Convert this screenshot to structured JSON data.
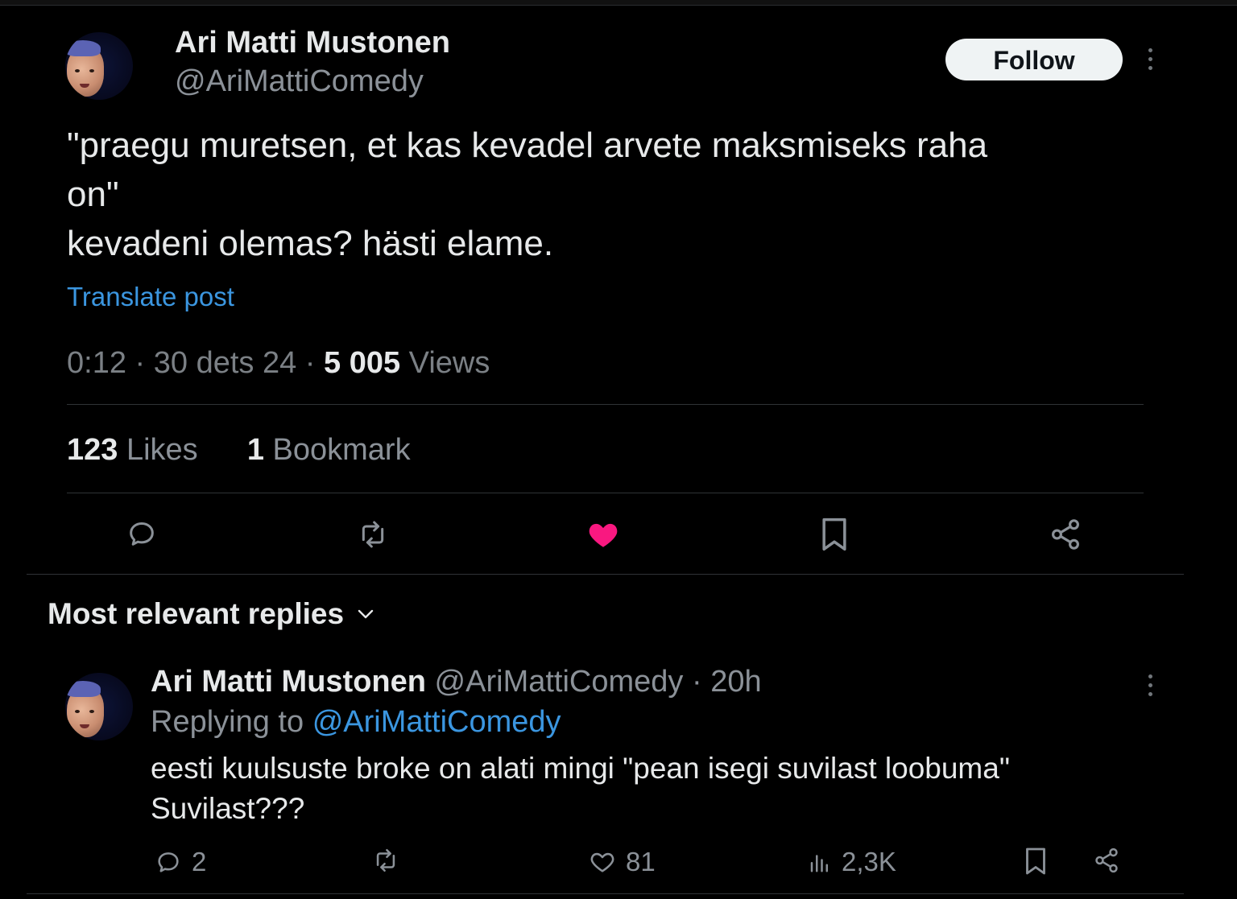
{
  "post": {
    "author_name": "Ari Matti Mustonen",
    "author_handle": "@AriMattiComedy",
    "follow_label": "Follow",
    "text_line1": "\"praegu muretsen, et kas kevadel arvete maksmiseks raha",
    "text_line2": "on\"",
    "text_line3": "kevadeni olemas? hästi elame.",
    "translate_label": "Translate post",
    "time": "0:12",
    "date": "30 dets 24",
    "views_count": "5 005",
    "views_label": "Views",
    "likes_count": "123",
    "likes_label": "Likes",
    "bookmarks_count": "1",
    "bookmarks_label": "Bookmark",
    "liked": true,
    "like_color": "#f91880"
  },
  "replies": {
    "heading": "Most relevant replies",
    "items": [
      {
        "author_name": "Ari Matti Mustonen",
        "author_handle": "@AriMattiComedy",
        "age": "20h",
        "replying_label": "Replying to",
        "replying_handle": "@AriMattiComedy",
        "text_line1": "eesti kuulsuste broke on alati mingi \"pean isegi suvilast loobuma\"",
        "text_line2": "Suvilast???",
        "reply_count": "2",
        "like_count": "81",
        "view_count": "2,3K"
      }
    ]
  },
  "colors": {
    "accent": "#3b96e0",
    "background": "#000000",
    "muted": "#8b9198"
  }
}
